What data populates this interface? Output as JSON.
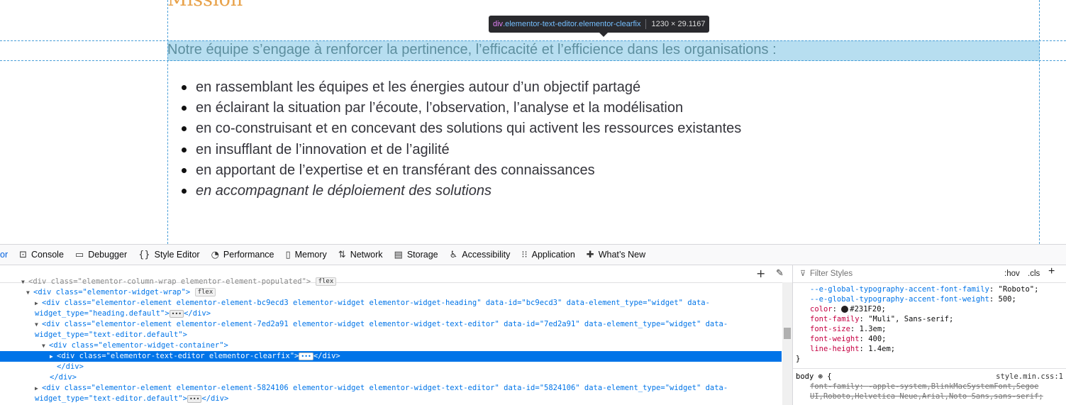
{
  "page": {
    "heading": "Mission",
    "intro": "Notre équipe s’engage à renforcer la pertinence, l’efficacité et l’efficience dans les organisations :",
    "bullets": [
      "en rassemblant les équipes et les énergies autour d’un objectif partagé",
      "en éclairant la situation par l’écoute, l’observation, l’analyse et la modélisation",
      "en co-construisant et en concevant des solutions qui activent les ressources existantes",
      "en insufflant de l’innovation et de l’agilité",
      "en apportant de l’expertise et en transférant des connaissances",
      "en accompagnant le déploiement des solutions"
    ],
    "highlight_color": "#87c8e6",
    "text_color": "#231F20"
  },
  "tooltip": {
    "tag": "div",
    "classes": ".elementor-text-editor.elementor-clearfix",
    "dims": "1230 × 29.1167"
  },
  "devtools": {
    "tabs": [
      {
        "label": "or",
        "icon": ""
      },
      {
        "label": "Console",
        "icon": "console-icon"
      },
      {
        "label": "Debugger",
        "icon": "debugger-icon"
      },
      {
        "label": "Style Editor",
        "icon": "braces-icon"
      },
      {
        "label": "Performance",
        "icon": "gauge-icon"
      },
      {
        "label": "Memory",
        "icon": "memory-icon"
      },
      {
        "label": "Network",
        "icon": "arrows-icon"
      },
      {
        "label": "Storage",
        "icon": "storage-icon"
      },
      {
        "label": "Accessibility",
        "icon": "accessibility-icon"
      },
      {
        "label": "Application",
        "icon": "grid-icon"
      },
      {
        "label": "What’s New",
        "icon": "gift-icon"
      }
    ],
    "markup": {
      "line0": "<div class=\"elementor-column-wrap elementor-element-populated\">",
      "line1_tag": "<div class=\"elementor-widget-wrap\">",
      "flex_badge": "flex",
      "line2": "<div class=\"elementor-element elementor-element-bc9ecd3 elementor-widget elementor-widget-heading\" data-id=\"bc9ecd3\" data-element_type=\"widget\" data-widget_type=\"heading.default\">",
      "line2_close": "</div>",
      "line3": "<div class=\"elementor-element elementor-element-7ed2a91 elementor-widget elementor-widget-text-editor\" data-id=\"7ed2a91\" data-element_type=\"widget\" data-widget_type=\"text-editor.default\">",
      "line4": "<div class=\"elementor-widget-container\">",
      "line5": "<div class=\"elementor-text-editor elementor-clearfix\">",
      "line5_close": "</div>",
      "line6": "</div>",
      "line7": "</div>",
      "line8": "<div class=\"elementor-element elementor-element-5824106 elementor-widget elementor-widget-text-editor\" data-id=\"5824106\" data-element_type=\"widget\" data-widget_type=\"text-editor.default\">",
      "line8_close": "</div>",
      "ellipsis": "•••"
    },
    "rules": {
      "filter_placeholder": "Filter Styles",
      "hov": ":hov",
      "cls": ".cls",
      "decls": [
        {
          "name": "--e-global-typography-accent-font-family",
          "value": "\"Roboto\";"
        },
        {
          "name": "--e-global-typography-accent-font-weight",
          "value": "500;"
        },
        {
          "name": "color",
          "value": "#231F20;"
        },
        {
          "name": "font-family",
          "value": "\"Muli\", Sans-serif;"
        },
        {
          "name": "font-size",
          "value": "1.3em;"
        },
        {
          "name": "font-weight",
          "value": "400;"
        },
        {
          "name": "line-height",
          "value": "1.4em;"
        }
      ],
      "close_brace": "}",
      "body_selector": "body",
      "open_brace": "{",
      "body_source": "style.min.css:1",
      "body_decl_name": "font-family",
      "body_decl_value": "-apple-system,BlinkMacSystemFont,Segoe UI,Roboto,Helvetica Neue,Arial,Noto Sans,sans-serif;"
    }
  }
}
